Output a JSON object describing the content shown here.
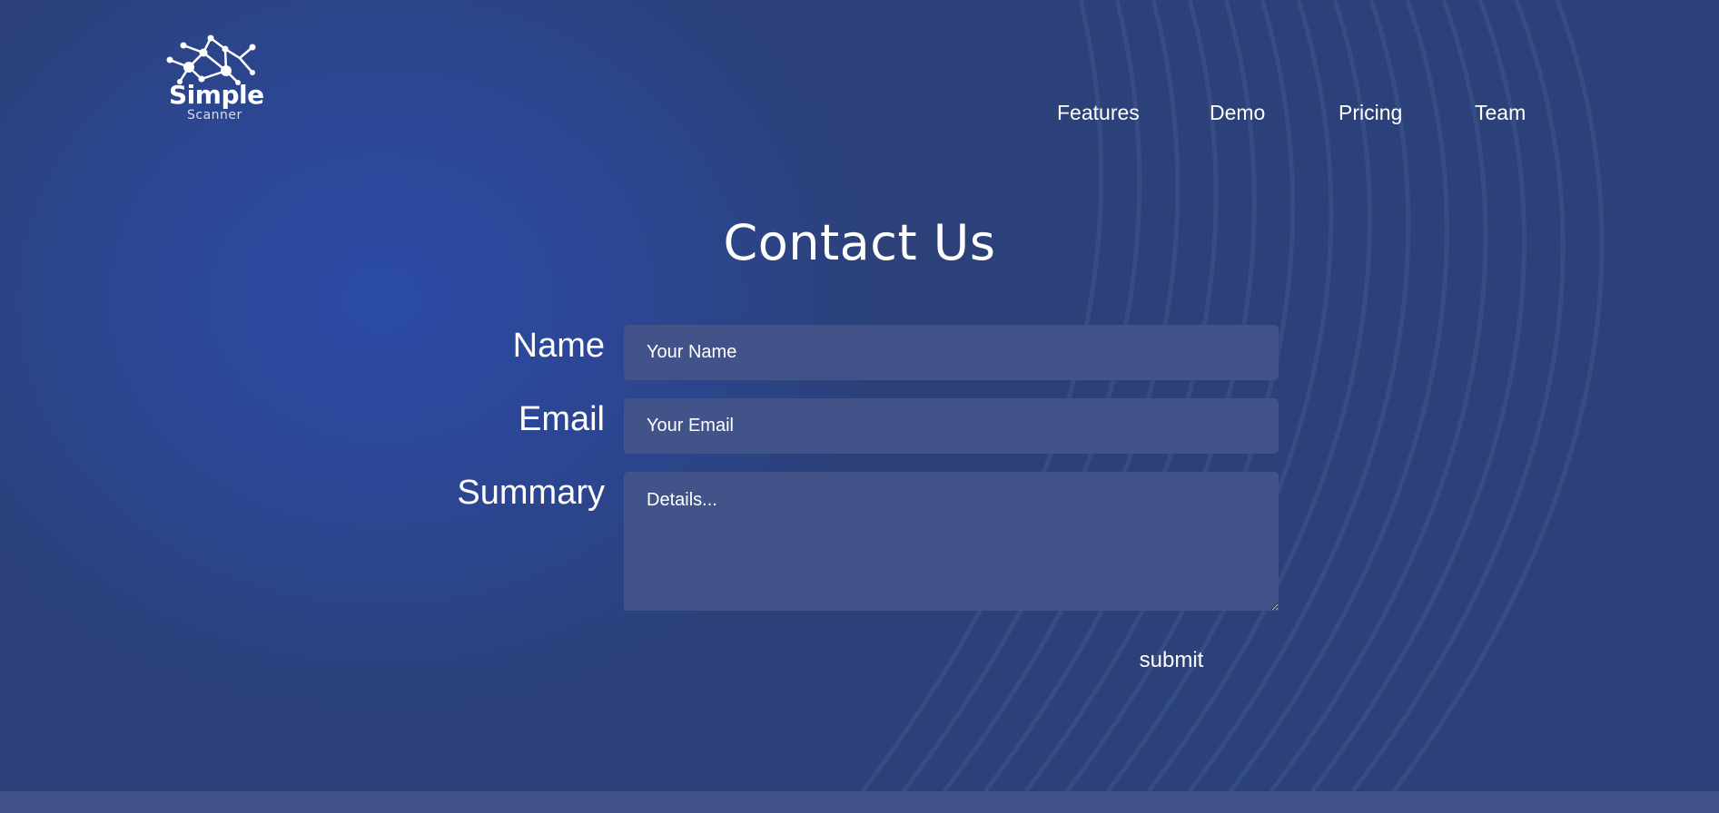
{
  "brand": {
    "name": "Simple",
    "tagline": "Scanner"
  },
  "nav": {
    "items": [
      {
        "label": "Features"
      },
      {
        "label": "Demo"
      },
      {
        "label": "Pricing"
      },
      {
        "label": "Team"
      }
    ]
  },
  "contact": {
    "title": "Contact Us",
    "name_label": "Name",
    "name_placeholder": "Your Name",
    "email_label": "Email",
    "email_placeholder": "Your Email",
    "summary_label": "Summary",
    "summary_placeholder": "Details...",
    "submit_label": "submit"
  },
  "colors": {
    "background": "#2c4179",
    "glow": "#2c4ca8",
    "field_background": "#42538a",
    "footer_strip": "#42528a",
    "text": "#ffffff"
  }
}
